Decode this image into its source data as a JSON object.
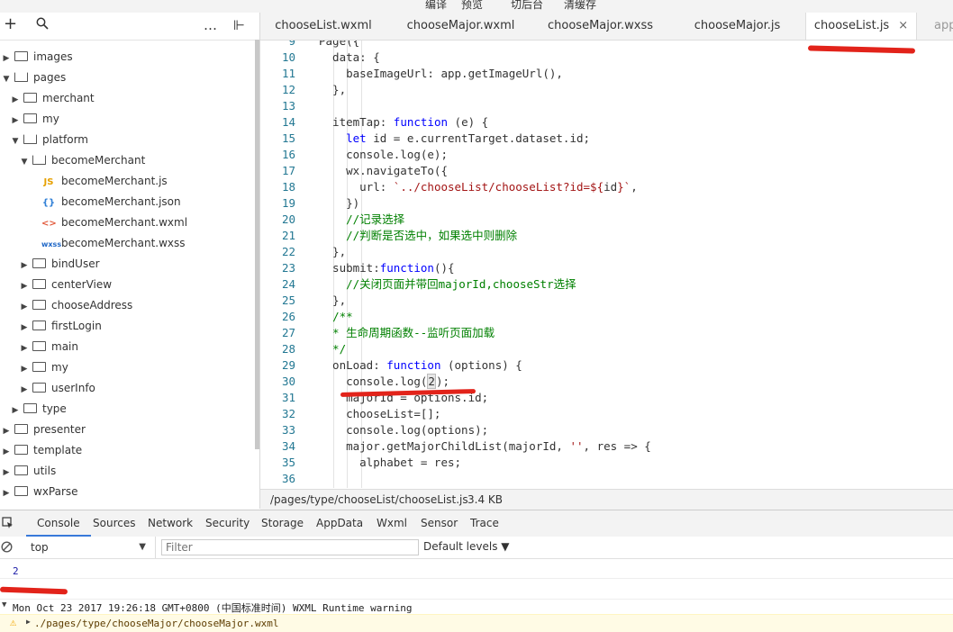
{
  "top_menu": [
    "编译",
    "预览",
    "切后台",
    "清缓存"
  ],
  "left_toolbar": {
    "add": "+",
    "search": "⚲",
    "more": "…",
    "collapse": "⊩"
  },
  "file_tree": [
    {
      "label": "images",
      "depth": 0,
      "kind": "folder",
      "open": false
    },
    {
      "label": "pages",
      "depth": 0,
      "kind": "folder",
      "open": true
    },
    {
      "label": "merchant",
      "depth": 1,
      "kind": "folder",
      "open": false
    },
    {
      "label": "my",
      "depth": 1,
      "kind": "folder",
      "open": false
    },
    {
      "label": "platform",
      "depth": 1,
      "kind": "folder",
      "open": true
    },
    {
      "label": "becomeMerchant",
      "depth": 2,
      "kind": "folder",
      "open": true
    },
    {
      "label": "becomeMerchant.js",
      "depth": 3,
      "kind": "js",
      "icon": "JS"
    },
    {
      "label": "becomeMerchant.json",
      "depth": 3,
      "kind": "json",
      "icon": "{}"
    },
    {
      "label": "becomeMerchant.wxml",
      "depth": 3,
      "kind": "wxml",
      "icon": "<>"
    },
    {
      "label": "becomeMerchant.wxss",
      "depth": 3,
      "kind": "wxss",
      "icon": "wxss"
    },
    {
      "label": "bindUser",
      "depth": 2,
      "kind": "folder",
      "open": false
    },
    {
      "label": "centerView",
      "depth": 2,
      "kind": "folder",
      "open": false
    },
    {
      "label": "chooseAddress",
      "depth": 2,
      "kind": "folder",
      "open": false
    },
    {
      "label": "firstLogin",
      "depth": 2,
      "kind": "folder",
      "open": false
    },
    {
      "label": "main",
      "depth": 2,
      "kind": "folder",
      "open": false
    },
    {
      "label": "my",
      "depth": 2,
      "kind": "folder",
      "open": false
    },
    {
      "label": "userInfo",
      "depth": 2,
      "kind": "folder",
      "open": false
    },
    {
      "label": "type",
      "depth": 1,
      "kind": "folder",
      "open": false
    },
    {
      "label": "presenter",
      "depth": 0,
      "kind": "folder",
      "open": false
    },
    {
      "label": "template",
      "depth": 0,
      "kind": "folder",
      "open": false
    },
    {
      "label": "utils",
      "depth": 0,
      "kind": "folder",
      "open": false
    },
    {
      "label": "wxParse",
      "depth": 0,
      "kind": "folder",
      "open": false
    }
  ],
  "tabs": [
    {
      "label": "chooseList.wxml",
      "active": false
    },
    {
      "label": "chooseMajor.wxml",
      "active": false
    },
    {
      "label": "chooseMajor.wxss",
      "active": false
    },
    {
      "label": "chooseMajor.js",
      "active": false
    },
    {
      "label": "chooseList.js",
      "active": true
    },
    {
      "label": "app",
      "active": false
    }
  ],
  "tab_close": "×",
  "code_lines": [
    {
      "n": "9",
      "segs": [
        [
          "p",
          "Page({"
        ]
      ]
    },
    {
      "n": "10",
      "segs": [
        [
          "p",
          "  data: {"
        ]
      ]
    },
    {
      "n": "11",
      "segs": [
        [
          "p",
          "    baseImageUrl: app.getImageUrl(),"
        ]
      ]
    },
    {
      "n": "12",
      "segs": [
        [
          "p",
          "  },"
        ]
      ]
    },
    {
      "n": "13",
      "segs": [
        [
          "p",
          ""
        ]
      ]
    },
    {
      "n": "14",
      "segs": [
        [
          "p",
          "  itemTap: "
        ],
        [
          "kw",
          "function"
        ],
        [
          "p",
          " (e) {"
        ]
      ]
    },
    {
      "n": "15",
      "segs": [
        [
          "p",
          "    "
        ],
        [
          "kw",
          "let"
        ],
        [
          "p",
          " id = e.currentTarget.dataset.id;"
        ]
      ]
    },
    {
      "n": "16",
      "segs": [
        [
          "p",
          "    console.log(e);"
        ]
      ]
    },
    {
      "n": "17",
      "segs": [
        [
          "p",
          "    wx.navigateTo({"
        ]
      ]
    },
    {
      "n": "18",
      "segs": [
        [
          "p",
          "      url: "
        ],
        [
          "str",
          "`../chooseList/chooseList?id=${"
        ],
        [
          "p",
          "id"
        ],
        [
          "str",
          "}`"
        ],
        [
          "p",
          ","
        ]
      ]
    },
    {
      "n": "19",
      "segs": [
        [
          "p",
          "    })"
        ]
      ]
    },
    {
      "n": "20",
      "segs": [
        [
          "p",
          "    "
        ],
        [
          "cm",
          "//记录选择"
        ]
      ]
    },
    {
      "n": "21",
      "segs": [
        [
          "p",
          "    "
        ],
        [
          "cm",
          "//判断是否选中，如果选中则删除"
        ]
      ]
    },
    {
      "n": "22",
      "segs": [
        [
          "p",
          "  },"
        ]
      ]
    },
    {
      "n": "23",
      "segs": [
        [
          "p",
          "  submit:"
        ],
        [
          "kw",
          "function"
        ],
        [
          "p",
          "(){"
        ]
      ]
    },
    {
      "n": "24",
      "segs": [
        [
          "p",
          "    "
        ],
        [
          "cm",
          "//关闭页面并带回majorId,chooseStr选择"
        ]
      ]
    },
    {
      "n": "25",
      "segs": [
        [
          "p",
          "  },"
        ]
      ]
    },
    {
      "n": "26",
      "segs": [
        [
          "p",
          "  "
        ],
        [
          "cm",
          "/**"
        ]
      ]
    },
    {
      "n": "27",
      "segs": [
        [
          "cm",
          "  * 生命周期函数--监听页面加载"
        ]
      ]
    },
    {
      "n": "28",
      "segs": [
        [
          "cm",
          "  */"
        ]
      ]
    },
    {
      "n": "29",
      "segs": [
        [
          "p",
          "  onLoad: "
        ],
        [
          "kw",
          "function"
        ],
        [
          "p",
          " (options) {"
        ]
      ]
    },
    {
      "n": "30",
      "segs": [
        [
          "p",
          "    console.log("
        ],
        [
          "hl",
          "2"
        ],
        [
          "p",
          ");"
        ]
      ]
    },
    {
      "n": "31",
      "segs": [
        [
          "p",
          "    majorId = options.id;"
        ]
      ]
    },
    {
      "n": "32",
      "segs": [
        [
          "p",
          "    chooseList=[];"
        ]
      ]
    },
    {
      "n": "33",
      "segs": [
        [
          "p",
          "    console.log(options);"
        ]
      ]
    },
    {
      "n": "34",
      "segs": [
        [
          "p",
          "    major.getMajorChildList(majorId, "
        ],
        [
          "str",
          "''"
        ],
        [
          "p",
          ", res => {"
        ]
      ]
    },
    {
      "n": "35",
      "segs": [
        [
          "p",
          "      alphabet = res;"
        ]
      ]
    },
    {
      "n": "36",
      "segs": [
        [
          "p",
          ""
        ]
      ]
    }
  ],
  "status": {
    "path": "/pages/type/chooseList/chooseList.js",
    "size": "3.4 KB"
  },
  "devtools_tabs": [
    "Console",
    "Sources",
    "Network",
    "Security",
    "Storage",
    "AppData",
    "Wxml",
    "Sensor",
    "Trace"
  ],
  "filter": {
    "context": "top",
    "placeholder": "Filter",
    "levels": "Default levels ▼"
  },
  "console": {
    "log_value": "2",
    "warning": "Mon Oct 23 2017 19:26:18 GMT+0800 (中国标准时间) WXML Runtime warning",
    "warning_path": "./pages/type/chooseMajor/chooseMajor.wxml"
  },
  "colors": {
    "accent": "#3879d9",
    "annotation_red": "#e2231a",
    "keyword": "#0000ff",
    "string": "#a31515",
    "comment": "#008000",
    "line_number": "#237893"
  }
}
